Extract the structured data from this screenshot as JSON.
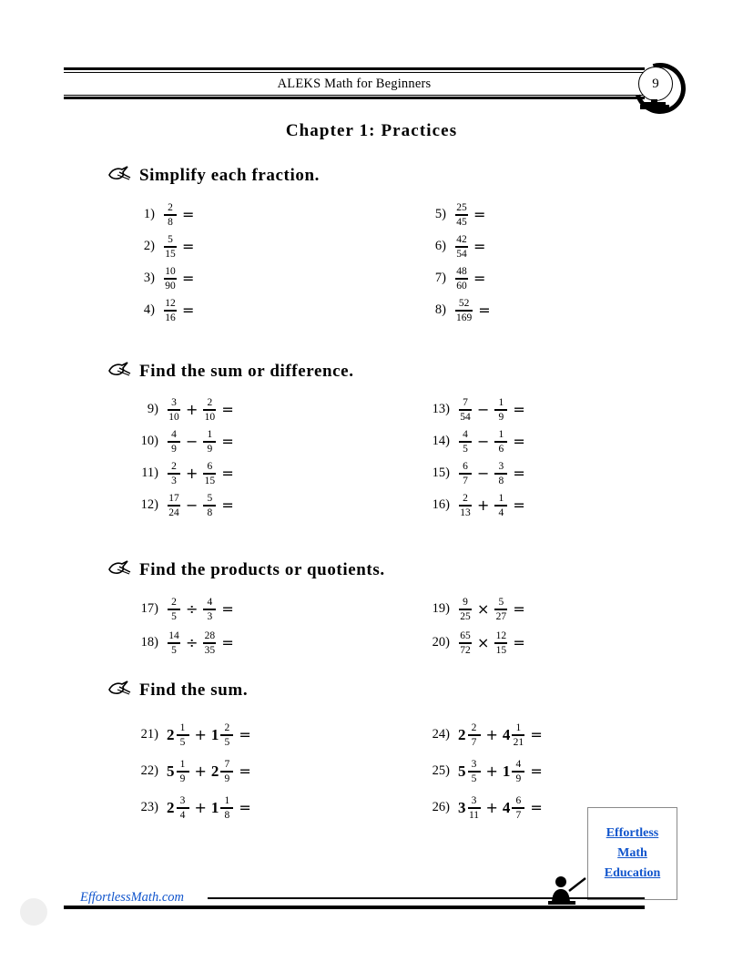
{
  "header": {
    "title": "ALEKS Math for Beginners",
    "page_number": "9",
    "globe_icon": "globe-icon"
  },
  "chapter_title": "Chapter 1: Practices",
  "sections": [
    {
      "icon": "pen-nib-icon",
      "heading": "Simplify each fraction.",
      "left": [
        {
          "n": "1)",
          "num": "2",
          "den": "8",
          "eq": "="
        },
        {
          "n": "2)",
          "num": "5",
          "den": "15",
          "eq": "="
        },
        {
          "n": "3)",
          "num": "10",
          "den": "90",
          "eq": "="
        },
        {
          "n": "4)",
          "num": "12",
          "den": "16",
          "eq": "="
        }
      ],
      "right": [
        {
          "n": "5)",
          "num": "25",
          "den": "45",
          "eq": "="
        },
        {
          "n": "6)",
          "num": "42",
          "den": "54",
          "eq": "="
        },
        {
          "n": "7)",
          "num": "48",
          "den": "60",
          "eq": "="
        },
        {
          "n": "8)",
          "num": "52",
          "den": "169",
          "eq": "="
        }
      ]
    },
    {
      "icon": "pen-nib-icon",
      "heading": "Find the sum or difference.",
      "left": [
        {
          "n": "9)",
          "num1": "3",
          "den1": "10",
          "op": "+",
          "num2": "2",
          "den2": "10",
          "eq": "="
        },
        {
          "n": "10)",
          "num1": "4",
          "den1": "9",
          "op": "−",
          "num2": "1",
          "den2": "9",
          "eq": "="
        },
        {
          "n": "11)",
          "num1": "2",
          "den1": "3",
          "op": "+",
          "num2": "6",
          "den2": "15",
          "eq": "="
        },
        {
          "n": "12)",
          "num1": "17",
          "den1": "24",
          "op": "−",
          "num2": "5",
          "den2": "8",
          "eq": "="
        }
      ],
      "right": [
        {
          "n": "13)",
          "num1": "7",
          "den1": "54",
          "op": "−",
          "num2": "1",
          "den2": "9",
          "eq": "="
        },
        {
          "n": "14)",
          "num1": "4",
          "den1": "5",
          "op": "−",
          "num2": "1",
          "den2": "6",
          "eq": "="
        },
        {
          "n": "15)",
          "num1": "6",
          "den1": "7",
          "op": "−",
          "num2": "3",
          "den2": "8",
          "eq": "="
        },
        {
          "n": "16)",
          "num1": "2",
          "den1": "13",
          "op": "+",
          "num2": "1",
          "den2": "4",
          "eq": "="
        }
      ]
    },
    {
      "icon": "pen-nib-icon",
      "heading": "Find the products or quotients.",
      "left": [
        {
          "n": "17)",
          "num1": "2",
          "den1": "5",
          "op": "÷",
          "num2": "4",
          "den2": "3",
          "eq": "="
        },
        {
          "n": "18)",
          "num1": "14",
          "den1": "5",
          "op": "÷",
          "num2": "28",
          "den2": "35",
          "eq": "="
        }
      ],
      "right": [
        {
          "n": "19)",
          "num1": "9",
          "den1": "25",
          "op": "×",
          "num2": "5",
          "den2": "27",
          "eq": "="
        },
        {
          "n": "20)",
          "num1": "65",
          "den1": "72",
          "op": "×",
          "num2": "12",
          "den2": "15",
          "eq": "="
        }
      ]
    },
    {
      "icon": "pen-nib-icon",
      "heading": "Find the sum.",
      "left": [
        {
          "n": "21)",
          "w1": "2",
          "num1": "1",
          "den1": "5",
          "op": "+",
          "w2": "1",
          "num2": "2",
          "den2": "5",
          "eq": "="
        },
        {
          "n": "22)",
          "w1": "5",
          "num1": "1",
          "den1": "9",
          "op": "+",
          "w2": "2",
          "num2": "7",
          "den2": "9",
          "eq": "="
        },
        {
          "n": "23)",
          "w1": "2",
          "num1": "3",
          "den1": "4",
          "op": "+",
          "w2": "1",
          "num2": "1",
          "den2": "8",
          "eq": "="
        }
      ],
      "right": [
        {
          "n": "24)",
          "w1": "2",
          "num1": "2",
          "den1": "7",
          "op": "+",
          "w2": "4",
          "num2": "1",
          "den2": "21",
          "eq": "="
        },
        {
          "n": "25)",
          "w1": "5",
          "num1": "3",
          "den1": "5",
          "op": "+",
          "w2": "1",
          "num2": "4",
          "den2": "9",
          "eq": "="
        },
        {
          "n": "26)",
          "w1": "3",
          "num1": "3",
          "den1": "11",
          "op": "+",
          "w2": "4",
          "num2": "6",
          "den2": "7",
          "eq": "="
        }
      ]
    }
  ],
  "footer": {
    "url": "EffortlessMath.com",
    "logo_line1": "Effortless",
    "logo_line2": "Math",
    "logo_line3": "Education",
    "teacher_icon": "teacher-pointer-icon",
    "link_color": "#1155cc"
  }
}
